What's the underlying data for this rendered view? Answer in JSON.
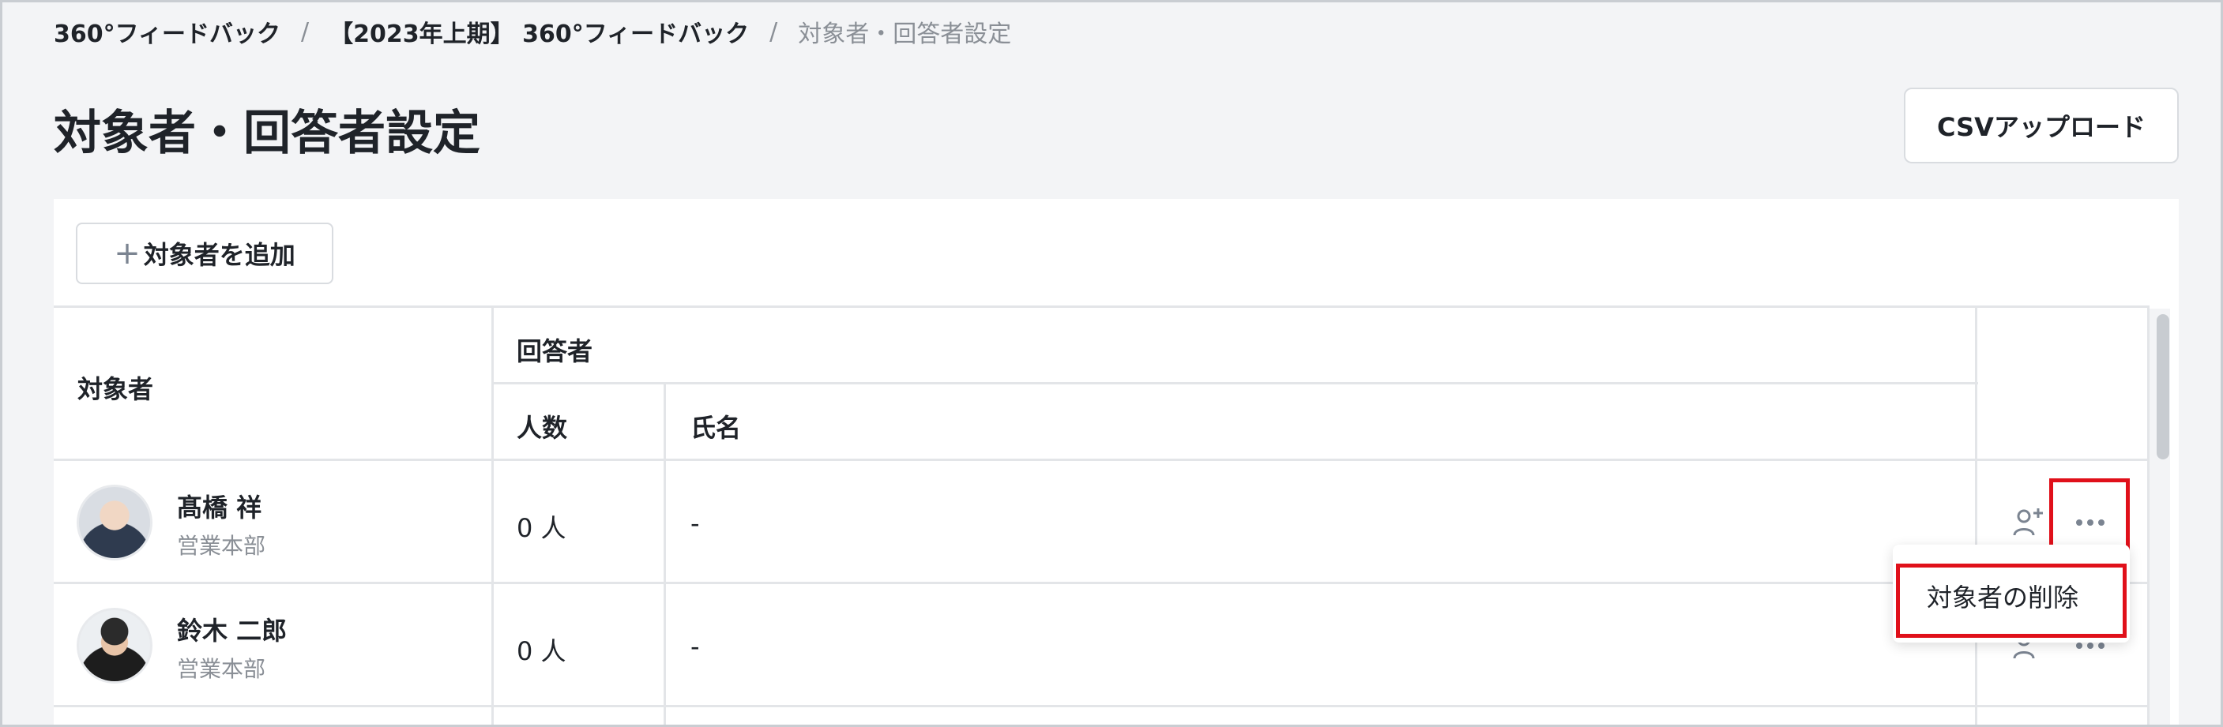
{
  "breadcrumb": {
    "items": [
      "360°フィードバック",
      "【2023年上期】 360°フィードバック"
    ],
    "current": "対象者・回答者設定",
    "separator": "/"
  },
  "page": {
    "title": "対象者・回答者設定",
    "csv_button": "CSVアップロード"
  },
  "toolbar": {
    "add_target_label": "対象者を追加"
  },
  "table": {
    "header": {
      "target": "対象者",
      "respondent_group": "回答者",
      "count": "人数",
      "names": "氏名"
    },
    "rows": [
      {
        "name": "髙橋 祥",
        "dept": "営業本部",
        "count": "0 人",
        "respondents": "-"
      },
      {
        "name": "鈴木 二郎",
        "dept": "営業本部",
        "count": "0 人",
        "respondents": "-"
      }
    ]
  },
  "context_menu": {
    "delete_target": "対象者の削除"
  },
  "icons": [
    "add-respondent-icon",
    "more-options-icon",
    "plus-icon"
  ],
  "colors": {
    "highlight": "#e0101a",
    "muted_text": "#8a8f96",
    "icon": "#7b8491"
  }
}
